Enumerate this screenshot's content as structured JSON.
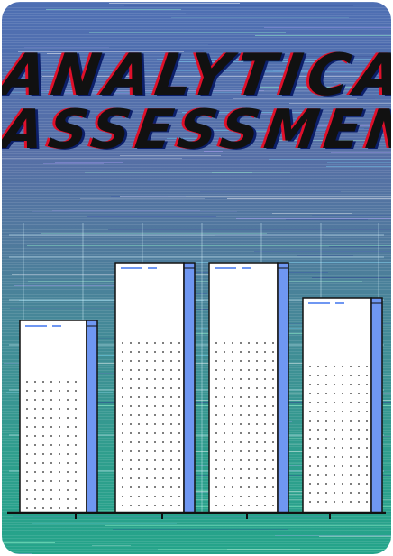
{
  "title": {
    "line1": "ANALYTICAL",
    "line2": "ASSESSMENT"
  },
  "colors": {
    "background_top": "#4e6fb3",
    "background_bottom": "#24a48a",
    "title_text": "#111111",
    "title_shadow_red": "#e0102a",
    "title_shadow_blue": "#0c1f6a",
    "bar_face": "#ffffff",
    "bar_side": "#6f97f2",
    "baseline": "#111111"
  },
  "illustration": {
    "bar_levels": [
      0.76,
      0.99,
      0.99,
      0.85
    ]
  }
}
